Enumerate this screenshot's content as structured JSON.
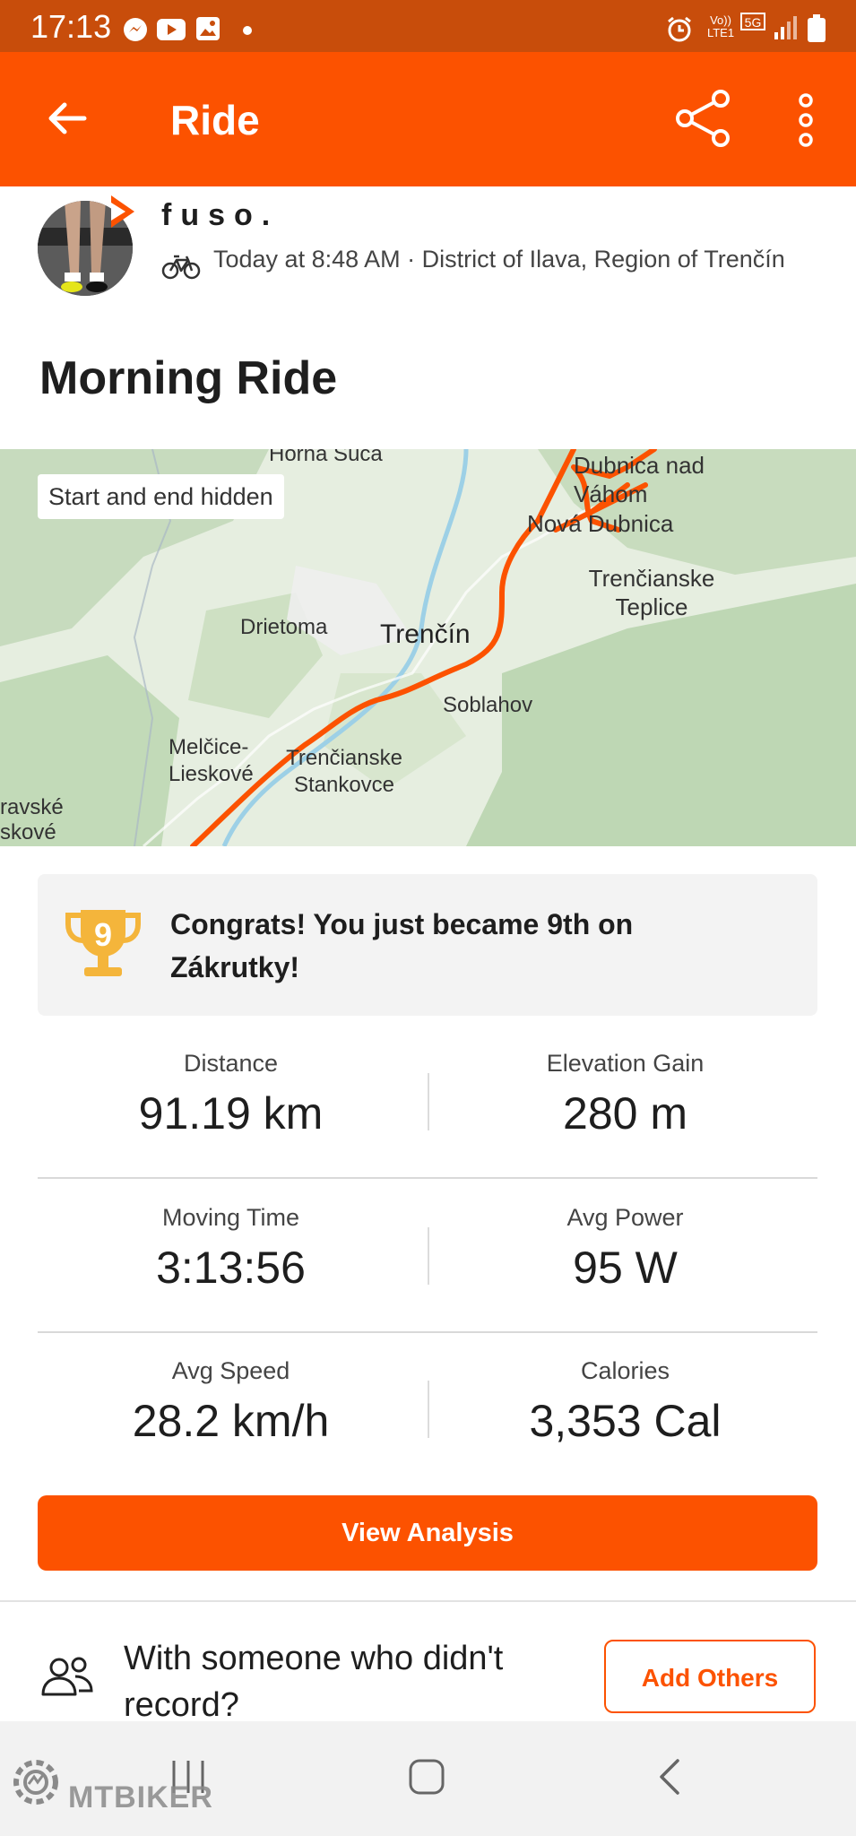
{
  "status_bar": {
    "time": "17:13",
    "network": "5G",
    "volte": "Vo)) LTE1"
  },
  "app_bar": {
    "title": "Ride",
    "back_icon": "arrow-left-icon",
    "share_icon": "share-icon",
    "more_icon": "more-vertical-icon"
  },
  "activity": {
    "username": "fuso.",
    "meta": "Today at 8:48 AM · District of Ilava, Region of Trenčín",
    "title": "Morning Ride"
  },
  "map": {
    "chip": "Start and end hidden",
    "labels": [
      "Horná Súča",
      "Dubnica nad Váhom",
      "Nová Dubnica",
      "Trenčianske Teplice",
      "Drietoma",
      "Trenčín",
      "Soblahov",
      "Melčice-Lieskové",
      "Trenčianske Stankovce",
      "ravské",
      "skové"
    ],
    "route_color": "#fc5200"
  },
  "congrats": {
    "rank": "9",
    "text": "Congrats! You just became 9th on Zákrutky!"
  },
  "stats": [
    {
      "label": "Distance",
      "value": "91.19 km"
    },
    {
      "label": "Elevation Gain",
      "value": "280 m"
    },
    {
      "label": "Moving Time",
      "value": "3:13:56"
    },
    {
      "label": "Avg Power",
      "value": "95 W"
    },
    {
      "label": "Avg Speed",
      "value": "28.2 km/h"
    },
    {
      "label": "Calories",
      "value": "3,353 Cal"
    }
  ],
  "buttons": {
    "view_analysis": "View Analysis",
    "add_others": "Add Others"
  },
  "with_someone": "With someone who didn't record?",
  "watermark": "MTBIKER",
  "colors": {
    "brand": "#fc5200",
    "status_bar": "#c84d0b"
  }
}
